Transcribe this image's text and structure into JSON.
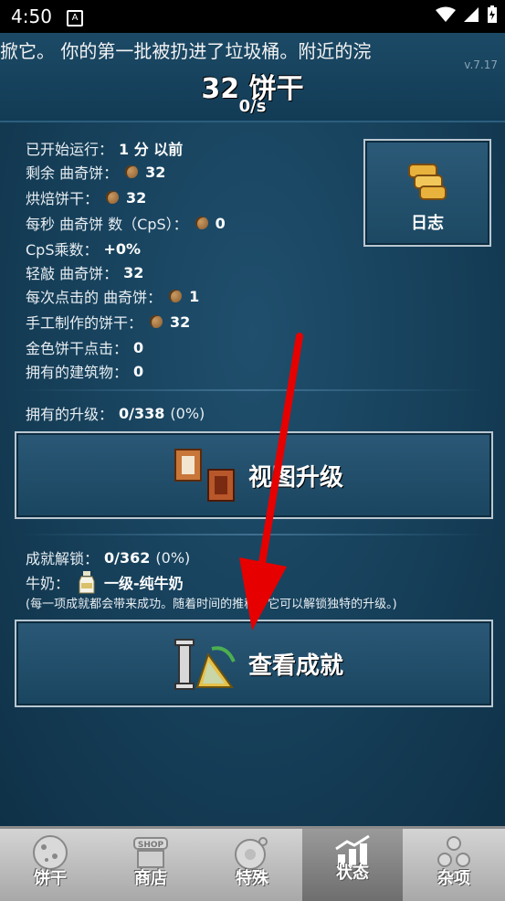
{
  "status_bar": {
    "time": "4:50",
    "notification_glyph": "A"
  },
  "header": {
    "ticker": "掀它。    你的第一批被扔进了垃圾桶。附近的浣",
    "version": "v.7.17",
    "cookies": "32 饼干",
    "per_second": "0/s"
  },
  "stats": {
    "started_label": "已开始运行：",
    "started_value": "1 分 以前",
    "remaining_label": "剩余 曲奇饼：",
    "remaining_value": "32",
    "baked_label": "烘焙饼干：",
    "baked_value": "32",
    "cps_label": "每秒 曲奇饼 数（CpS）：",
    "cps_value": "0",
    "mult_label": "CpS乘数：",
    "mult_value": "+0%",
    "clicks_label": "轻敲 曲奇饼：",
    "clicks_value": "32",
    "per_click_label": "每次点击的 曲奇饼：",
    "per_click_value": "1",
    "handmade_label": "手工制作的饼干：",
    "handmade_value": "32",
    "golden_label": "金色饼干点击：",
    "golden_value": "0",
    "buildings_label": "拥有的建筑物：",
    "buildings_value": "0"
  },
  "log_button": {
    "label": "日志",
    "icon": "scroll-icon"
  },
  "upgrades": {
    "label": "拥有的升级：",
    "value": "0/338",
    "percent": "(0%)",
    "button_label": "视图升级",
    "icon": "upgrade-cards-icon"
  },
  "achievements": {
    "label": "成就解锁：",
    "value": "0/362",
    "percent": "(0%)",
    "milk_label": "牛奶：",
    "milk_value": "一级-纯牛奶",
    "note": "(每一项成就都会带来成功。随着时间的推移，它可以解锁独特的升级。)",
    "button_label": "查看成就",
    "icon": "achievement-trophy-icon"
  },
  "bottom_nav": [
    {
      "label": "饼干",
      "icon": "cookie-icon"
    },
    {
      "label": "商店",
      "icon": "shop-icon"
    },
    {
      "label": "特殊",
      "icon": "special-icon"
    },
    {
      "label": "状态",
      "icon": "stats-icon"
    },
    {
      "label": "杂项",
      "icon": "misc-icon"
    }
  ],
  "colors": {
    "panel": "#163f59",
    "arrow": "#e60000",
    "nav": "#bdbdbd"
  }
}
